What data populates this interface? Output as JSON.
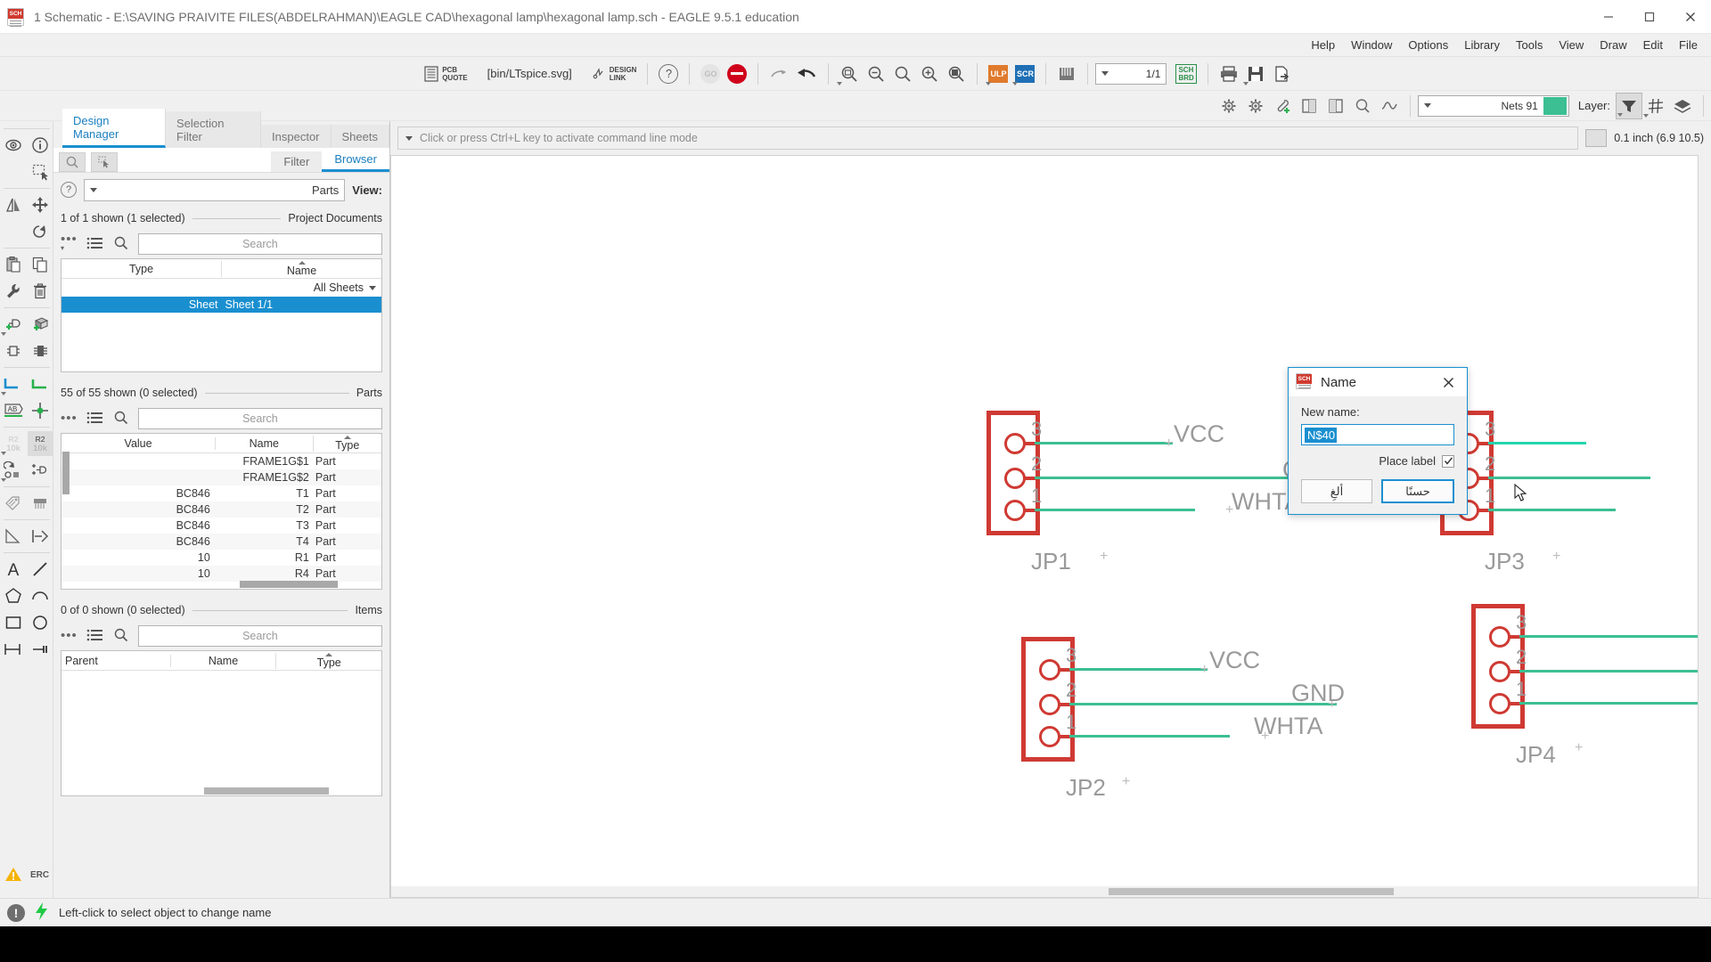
{
  "window": {
    "title": "1 Schematic - E:\\SAVING PRAIVITE FILES(ABDELRAHMAN)\\EAGLE CAD\\hexagonal lamp\\hexagonal lamp.sch - EAGLE 9.5.1 education",
    "app_icon": "sch-file-icon",
    "minimize": "–",
    "maximize": "❐",
    "close": "✕"
  },
  "menubar": {
    "items": [
      "Help",
      "Window",
      "Options",
      "Library",
      "Tools",
      "View",
      "Draw",
      "Edit",
      "File"
    ]
  },
  "toolbar": {
    "pcb_quote": "PCB\nQUOTE",
    "pcb_quote_line1": "PCB",
    "pcb_quote_line2": "QUOTE",
    "ltspice": "[bin/LTspice.svg]",
    "design_link_line1": "DESIGN",
    "design_link_line2": "LINK",
    "help": "?",
    "go_disabled": "GO",
    "stop": "stop-icon",
    "redo": "redo-icon",
    "undo": "undo-icon",
    "zoom_fit": "zoom-fit-icon",
    "zoom_out": "zoom-out-icon",
    "zoom_select": "zoom-select-icon",
    "zoom_in": "zoom-in-icon",
    "zoom_redraw": "zoom-redraw-icon",
    "ulp": "ULP",
    "scr": "SCR",
    "library": "library-icon",
    "sheet_value": "1/1",
    "sch_brd_line1": "SCH",
    "sch_brd_line2": "BRD",
    "print": "print-icon",
    "save": "save-icon",
    "export": "export-icon"
  },
  "toolbar2": {
    "net_label": "Nets 91",
    "net_color": "#3cbf92",
    "layer_label": "Layer:",
    "icons": [
      "drc-settings-icon",
      "erc-settings-icon",
      "attach-icon",
      "board-left-icon",
      "board-right-icon",
      "zoom-net-icon",
      "signal-icon",
      "filter-icon",
      "grid-icon",
      "layers-icon"
    ]
  },
  "panel": {
    "tabs": [
      {
        "label": "Design Manager",
        "active": true
      },
      {
        "label": "Selection Filter",
        "active": false
      },
      {
        "label": "Inspector",
        "active": false
      },
      {
        "label": "Sheets",
        "active": false
      }
    ],
    "subtabs": [
      {
        "label": "Filter",
        "active": false
      },
      {
        "label": "Browser",
        "active": true
      }
    ],
    "filter_row": {
      "help": "?",
      "parts_label": "Parts",
      "view_label": "View:"
    },
    "sections": [
      {
        "id": "documents",
        "count_text": "1 of 1 shown (1 selected)",
        "title": "Project Documents",
        "search_placeholder": "Search",
        "columns": [
          "Type",
          "Name"
        ],
        "subrow": "All Sheets",
        "rows": [
          {
            "type": "Sheet",
            "name": "Sheet 1/1",
            "selected": true
          }
        ]
      },
      {
        "id": "parts",
        "count_text": "55 of 55 shown (0 selected)",
        "title": "Parts",
        "search_placeholder": "Search",
        "columns": [
          "Value",
          "Name",
          "Type"
        ],
        "rows": [
          {
            "value": "",
            "name": "FRAME1G$1",
            "type": "Part"
          },
          {
            "value": "",
            "name": "FRAME1G$2",
            "type": "Part"
          },
          {
            "value": "BC846",
            "name": "T1",
            "type": "Part"
          },
          {
            "value": "BC846",
            "name": "T2",
            "type": "Part"
          },
          {
            "value": "BC846",
            "name": "T3",
            "type": "Part"
          },
          {
            "value": "BC846",
            "name": "T4",
            "type": "Part"
          },
          {
            "value": "10",
            "name": "R1",
            "type": "Part"
          },
          {
            "value": "10",
            "name": "R4",
            "type": "Part"
          }
        ]
      },
      {
        "id": "items",
        "count_text": "0 of 0 shown (0 selected)",
        "title": "Items",
        "search_placeholder": "Search",
        "columns": [
          "Parent",
          "Name",
          "Type"
        ],
        "rows": []
      }
    ]
  },
  "command_line": {
    "placeholder": "Click or press Ctrl+L key to activate command line mode",
    "coords": "0.1 inch (6.9 10.5)"
  },
  "schematic": {
    "connectors": [
      {
        "name": "JP1",
        "pins": [
          "3",
          "2",
          "1"
        ],
        "labels": [
          "VCC",
          "GND",
          "WHTA"
        ]
      },
      {
        "name": "JP3",
        "pins": [
          "3",
          "2",
          "1"
        ],
        "labels": []
      },
      {
        "name": "JP2",
        "pins": [
          "3",
          "2",
          "1"
        ],
        "labels": [
          "VCC",
          "GND",
          "WHTA"
        ]
      },
      {
        "name": "JP4",
        "pins": [
          "3",
          "2",
          "1"
        ],
        "labels": []
      }
    ],
    "net_labels": [
      "VCC",
      "GND",
      "WHTA"
    ],
    "wire_color": "#3cbf92",
    "symbol_color": "#cf3a33",
    "text_color": "#9a9a9a"
  },
  "dialog": {
    "title": "Name",
    "icon": "sch-file-icon",
    "close": "✕",
    "field_label": "New name:",
    "field_value": "N$40",
    "checkbox_label": "Place label",
    "checkbox_checked": true,
    "cancel_button": "ألغِ",
    "ok_button": "حسنًا"
  },
  "statusbar": {
    "message": "Left-click to select object to change name",
    "warn_icon": "!",
    "bolt_icon": "⚡"
  }
}
